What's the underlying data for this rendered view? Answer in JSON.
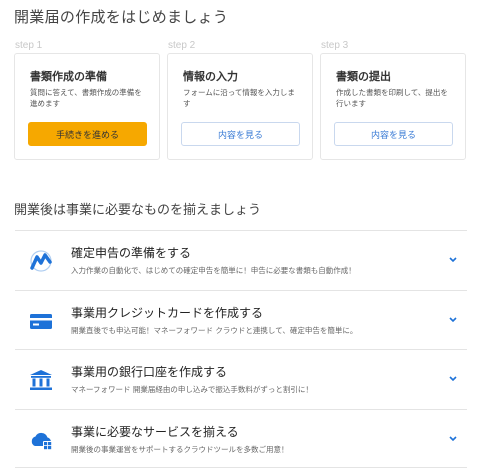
{
  "page": {
    "title": "開業届の作成をはじめましょう",
    "subtitle": "開業後は事業に必要なものを揃えましょう"
  },
  "steps": [
    {
      "label": "step 1",
      "title": "書類作成の準備",
      "desc": "質問に答えて、書類作成の準備を進めます",
      "button": "手続きを進める"
    },
    {
      "label": "step 2",
      "title": "情報の入力",
      "desc": "フォームに沿って情報を入力します",
      "button": "内容を見る"
    },
    {
      "label": "step 3",
      "title": "書類の提出",
      "desc": "作成した書類を印刷して、提出を行います",
      "button": "内容を見る"
    }
  ],
  "services": [
    {
      "icon": "mf-logo-icon",
      "title": "確定申告の準備をする",
      "desc": "入力作業の自動化で、はじめての確定申告を簡単に！申告に必要な書類も自動作成！"
    },
    {
      "icon": "credit-card-icon",
      "title": "事業用クレジットカードを作成する",
      "desc": "開業直後でも申込可能！マネーフォワード クラウドと連携して、確定申告を簡単に。"
    },
    {
      "icon": "bank-icon",
      "title": "事業用の銀行口座を作成する",
      "desc": "マネーフォワード 開業届経由の申し込みで振込手数料がずっと割引に！"
    },
    {
      "icon": "cloud-icon",
      "title": "事業に必要なサービスを揃える",
      "desc": "開業後の事業運営をサポートするクラウドツールを多数ご用意！"
    }
  ],
  "colors": {
    "accent": "#f6a800",
    "link": "#3a7bd5",
    "icon": "#1e72d8"
  }
}
